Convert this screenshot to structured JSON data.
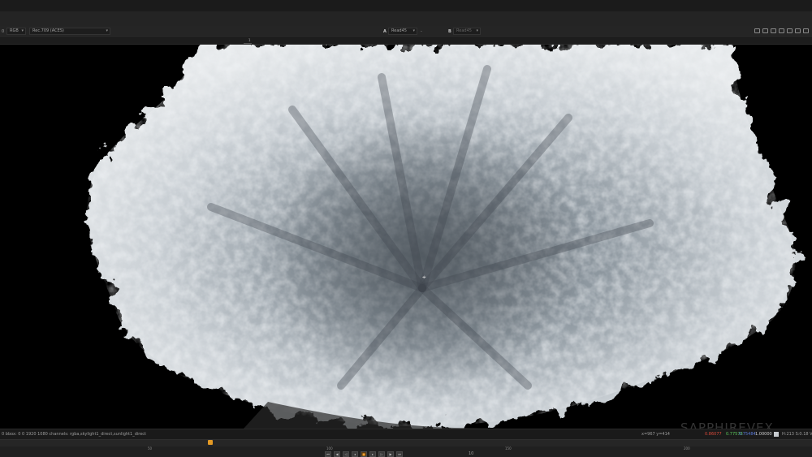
{
  "toolbar": {
    "view_number": "0",
    "channel": "RGB",
    "lut": "Rec.709 (ACES)",
    "a_label": "A",
    "a_node": "Read45",
    "a_extra": "-",
    "b_label": "B",
    "b_node": "Read45",
    "frame_label": "1"
  },
  "status": {
    "info": "0  bbox: 0 0 1920 1080  channels: rgba,skylight1_direct,sunlight1_direct",
    "coords": "x=967 y=414",
    "r": "0.86077",
    "g": "0.77578",
    "b": "0.75484",
    "a": "1.00000",
    "hsv": "H:213 S:0.18 V"
  },
  "watermark": "SAPPHIREVEX",
  "timeline": {
    "ticks": [
      "50",
      "100",
      "150",
      "200"
    ],
    "frame": "10"
  },
  "colors": {
    "accent": "#e39a25",
    "background": "#141414"
  }
}
